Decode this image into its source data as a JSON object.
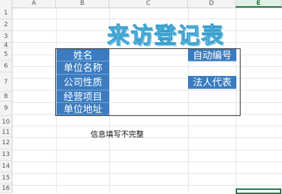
{
  "columns": [
    {
      "label": "A",
      "selected": false
    },
    {
      "label": "B",
      "selected": false
    },
    {
      "label": "C",
      "selected": false
    },
    {
      "label": "D",
      "selected": false
    },
    {
      "label": "E",
      "selected": true
    }
  ],
  "rows": [
    "1",
    "2",
    "3",
    "4",
    "5",
    "6",
    "7",
    "8",
    "9",
    "10",
    "11",
    "12",
    "13",
    "14",
    "15",
    "16"
  ],
  "title": "来访登记表",
  "form": {
    "labels": [
      "姓名",
      "单位名称",
      "公司性质",
      "经营项目",
      "单位地址"
    ],
    "right_labels": [
      "自动编号",
      "法人代表"
    ]
  },
  "message": "信息填写不完整",
  "colors": {
    "header_fill": "#3b7cc0",
    "accent": "#217346",
    "title": "#3a9fcf"
  }
}
